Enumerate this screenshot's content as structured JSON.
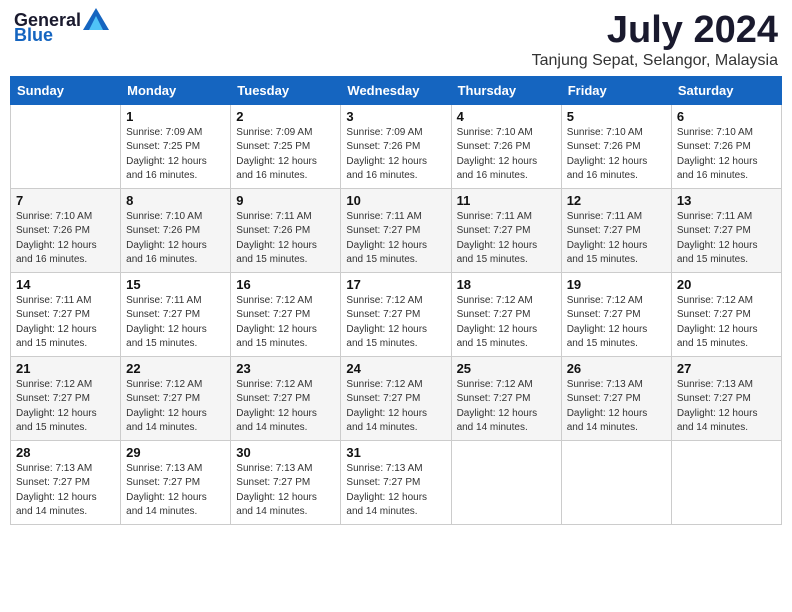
{
  "logo": {
    "general": "General",
    "blue": "Blue"
  },
  "title": "July 2024",
  "location": "Tanjung Sepat, Selangor, Malaysia",
  "days_of_week": [
    "Sunday",
    "Monday",
    "Tuesday",
    "Wednesday",
    "Thursday",
    "Friday",
    "Saturday"
  ],
  "weeks": [
    [
      {
        "day": "",
        "sunrise": "",
        "sunset": "",
        "daylight": ""
      },
      {
        "day": "1",
        "sunrise": "7:09 AM",
        "sunset": "7:25 PM",
        "daylight": "12 hours and 16 minutes."
      },
      {
        "day": "2",
        "sunrise": "7:09 AM",
        "sunset": "7:25 PM",
        "daylight": "12 hours and 16 minutes."
      },
      {
        "day": "3",
        "sunrise": "7:09 AM",
        "sunset": "7:26 PM",
        "daylight": "12 hours and 16 minutes."
      },
      {
        "day": "4",
        "sunrise": "7:10 AM",
        "sunset": "7:26 PM",
        "daylight": "12 hours and 16 minutes."
      },
      {
        "day": "5",
        "sunrise": "7:10 AM",
        "sunset": "7:26 PM",
        "daylight": "12 hours and 16 minutes."
      },
      {
        "day": "6",
        "sunrise": "7:10 AM",
        "sunset": "7:26 PM",
        "daylight": "12 hours and 16 minutes."
      }
    ],
    [
      {
        "day": "7",
        "sunrise": "7:10 AM",
        "sunset": "7:26 PM",
        "daylight": "12 hours and 16 minutes."
      },
      {
        "day": "8",
        "sunrise": "7:10 AM",
        "sunset": "7:26 PM",
        "daylight": "12 hours and 16 minutes."
      },
      {
        "day": "9",
        "sunrise": "7:11 AM",
        "sunset": "7:26 PM",
        "daylight": "12 hours and 15 minutes."
      },
      {
        "day": "10",
        "sunrise": "7:11 AM",
        "sunset": "7:27 PM",
        "daylight": "12 hours and 15 minutes."
      },
      {
        "day": "11",
        "sunrise": "7:11 AM",
        "sunset": "7:27 PM",
        "daylight": "12 hours and 15 minutes."
      },
      {
        "day": "12",
        "sunrise": "7:11 AM",
        "sunset": "7:27 PM",
        "daylight": "12 hours and 15 minutes."
      },
      {
        "day": "13",
        "sunrise": "7:11 AM",
        "sunset": "7:27 PM",
        "daylight": "12 hours and 15 minutes."
      }
    ],
    [
      {
        "day": "14",
        "sunrise": "7:11 AM",
        "sunset": "7:27 PM",
        "daylight": "12 hours and 15 minutes."
      },
      {
        "day": "15",
        "sunrise": "7:11 AM",
        "sunset": "7:27 PM",
        "daylight": "12 hours and 15 minutes."
      },
      {
        "day": "16",
        "sunrise": "7:12 AM",
        "sunset": "7:27 PM",
        "daylight": "12 hours and 15 minutes."
      },
      {
        "day": "17",
        "sunrise": "7:12 AM",
        "sunset": "7:27 PM",
        "daylight": "12 hours and 15 minutes."
      },
      {
        "day": "18",
        "sunrise": "7:12 AM",
        "sunset": "7:27 PM",
        "daylight": "12 hours and 15 minutes."
      },
      {
        "day": "19",
        "sunrise": "7:12 AM",
        "sunset": "7:27 PM",
        "daylight": "12 hours and 15 minutes."
      },
      {
        "day": "20",
        "sunrise": "7:12 AM",
        "sunset": "7:27 PM",
        "daylight": "12 hours and 15 minutes."
      }
    ],
    [
      {
        "day": "21",
        "sunrise": "7:12 AM",
        "sunset": "7:27 PM",
        "daylight": "12 hours and 15 minutes."
      },
      {
        "day": "22",
        "sunrise": "7:12 AM",
        "sunset": "7:27 PM",
        "daylight": "12 hours and 14 minutes."
      },
      {
        "day": "23",
        "sunrise": "7:12 AM",
        "sunset": "7:27 PM",
        "daylight": "12 hours and 14 minutes."
      },
      {
        "day": "24",
        "sunrise": "7:12 AM",
        "sunset": "7:27 PM",
        "daylight": "12 hours and 14 minutes."
      },
      {
        "day": "25",
        "sunrise": "7:12 AM",
        "sunset": "7:27 PM",
        "daylight": "12 hours and 14 minutes."
      },
      {
        "day": "26",
        "sunrise": "7:13 AM",
        "sunset": "7:27 PM",
        "daylight": "12 hours and 14 minutes."
      },
      {
        "day": "27",
        "sunrise": "7:13 AM",
        "sunset": "7:27 PM",
        "daylight": "12 hours and 14 minutes."
      }
    ],
    [
      {
        "day": "28",
        "sunrise": "7:13 AM",
        "sunset": "7:27 PM",
        "daylight": "12 hours and 14 minutes."
      },
      {
        "day": "29",
        "sunrise": "7:13 AM",
        "sunset": "7:27 PM",
        "daylight": "12 hours and 14 minutes."
      },
      {
        "day": "30",
        "sunrise": "7:13 AM",
        "sunset": "7:27 PM",
        "daylight": "12 hours and 14 minutes."
      },
      {
        "day": "31",
        "sunrise": "7:13 AM",
        "sunset": "7:27 PM",
        "daylight": "12 hours and 14 minutes."
      },
      {
        "day": "",
        "sunrise": "",
        "sunset": "",
        "daylight": ""
      },
      {
        "day": "",
        "sunrise": "",
        "sunset": "",
        "daylight": ""
      },
      {
        "day": "",
        "sunrise": "",
        "sunset": "",
        "daylight": ""
      }
    ]
  ],
  "labels": {
    "sunrise_prefix": "Sunrise: ",
    "sunset_prefix": "Sunset: ",
    "daylight_prefix": "Daylight: "
  },
  "colors": {
    "header_bg": "#1565c0",
    "header_text": "#ffffff",
    "accent": "#1565c0"
  }
}
